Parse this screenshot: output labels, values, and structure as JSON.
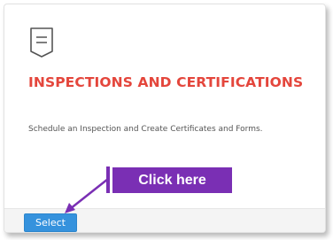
{
  "card": {
    "icon": "form-document-icon",
    "title": "INSPECTIONS AND CERTIFICATIONS",
    "description": "Schedule an Inspection and Create Certificates and Forms."
  },
  "footer": {
    "select_label": "Select"
  },
  "callout": {
    "label": "Click here",
    "color": "#7a2fb4"
  },
  "colors": {
    "title": "#e4463c",
    "button": "#3592dd"
  }
}
